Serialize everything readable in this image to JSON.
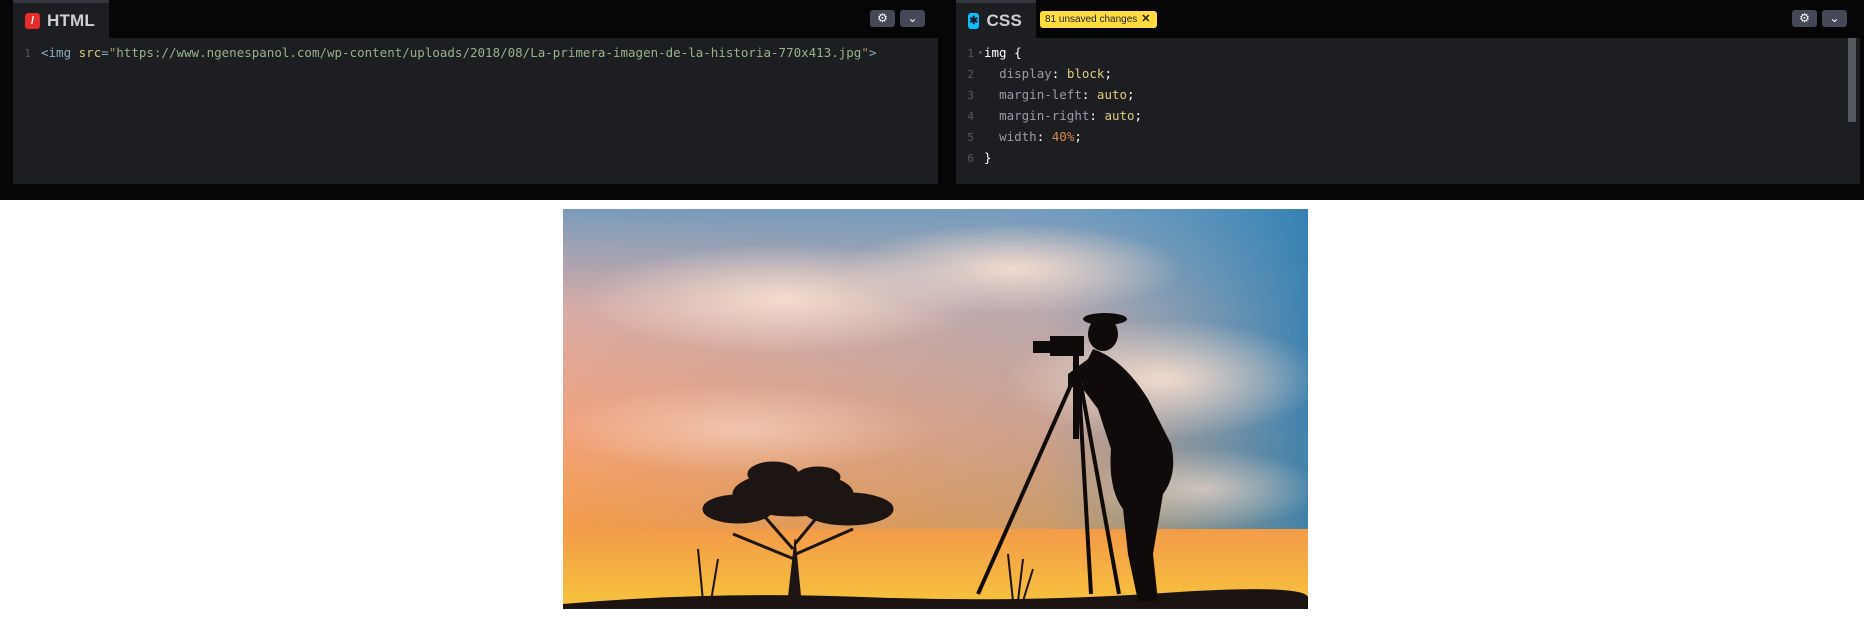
{
  "html_pane": {
    "tab_label": "HTML",
    "icon": "html-slash-icon",
    "code_line": {
      "number": "1",
      "open": "<img ",
      "attr": "src",
      "eq": "=",
      "quote_open": "\"",
      "url": "https://www.ngenespanol.com/wp-content/uploads/2018/08/La-primera-imagen-de-la-historia-770x413.jpg",
      "quote_close": "\"",
      "close": ">"
    }
  },
  "css_pane": {
    "tab_label": "CSS",
    "icon": "css-asterisk-icon",
    "unsaved_badge": "81 unsaved changes",
    "lines": [
      {
        "n": "1",
        "selector": "img",
        "brace": " {"
      },
      {
        "n": "2",
        "prop": "display",
        "value": "block"
      },
      {
        "n": "3",
        "prop": "margin-left",
        "value": "auto"
      },
      {
        "n": "4",
        "prop": "margin-right",
        "value": "auto"
      },
      {
        "n": "5",
        "prop": "width",
        "value": "40%"
      },
      {
        "n": "6",
        "brace": "}"
      }
    ]
  },
  "preview": {
    "image_description_icon": "photographer-silhouette-sunset-photo"
  },
  "colors": {
    "editor_bg": "#1d1e22",
    "chrome_bg": "#060606",
    "badge": "#ffdd40",
    "html_icon": "#e42c2c",
    "css_icon": "#0ebeff"
  }
}
